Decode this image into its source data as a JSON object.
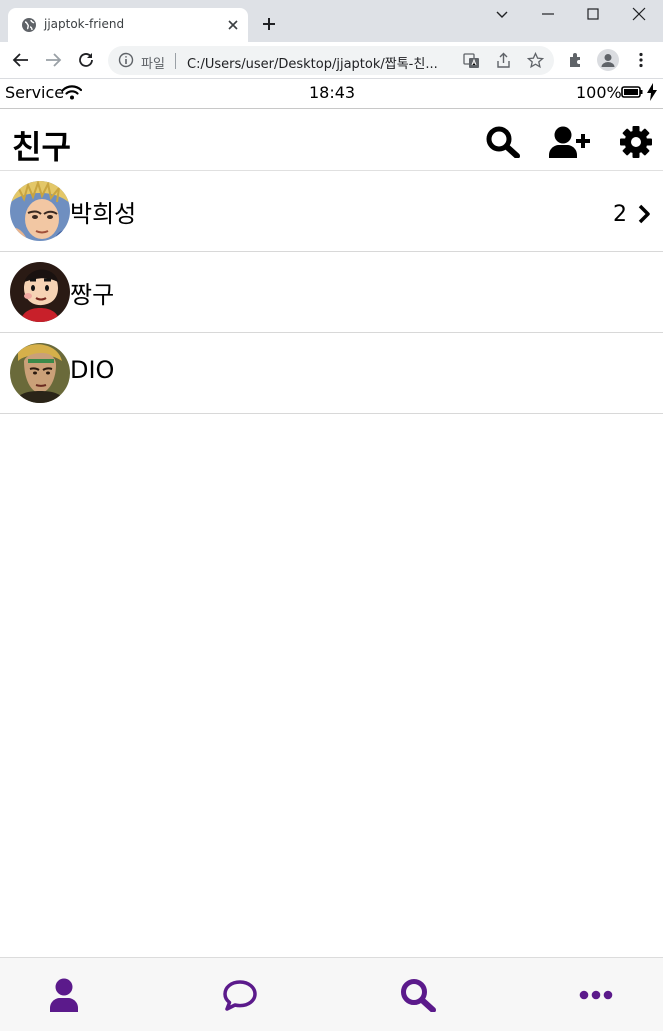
{
  "browser": {
    "tab_title": "jjaptok-friend",
    "scheme_label": "파일",
    "url": "C:/Users/user/Desktop/jjaptok/짭톡-친..."
  },
  "statusbar": {
    "carrier": "Service",
    "time": "18:43",
    "battery": "100%"
  },
  "header": {
    "title": "친구",
    "icons": [
      "search-icon",
      "add-user-icon",
      "gear-icon"
    ]
  },
  "friends": [
    {
      "name": "박희성",
      "unread": "2",
      "has_chevron": true
    },
    {
      "name": "짱구",
      "unread": "",
      "has_chevron": false
    },
    {
      "name": "DIO",
      "unread": "",
      "has_chevron": false
    }
  ],
  "bottom_nav": {
    "items": [
      "friends-icon",
      "chat-icon",
      "search-icon",
      "more-icon"
    ],
    "accent": "#5b1a8b"
  }
}
